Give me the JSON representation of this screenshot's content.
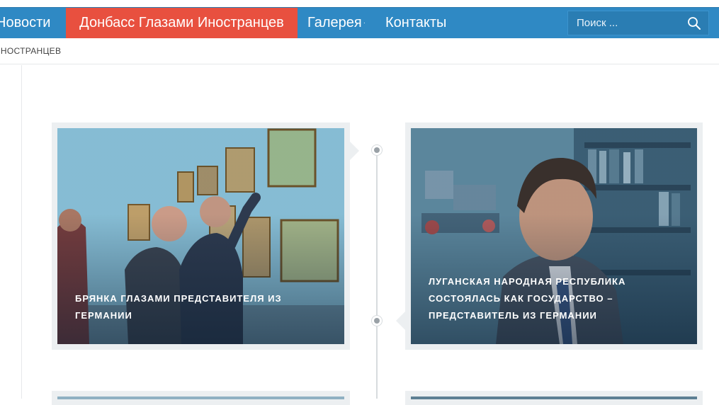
{
  "nav": {
    "items": [
      {
        "label": "Новости"
      },
      {
        "label": "Донбасс Глазами Иностранцев"
      },
      {
        "label": "Галерея"
      },
      {
        "label": "Контакты"
      }
    ],
    "active_index": 1,
    "gallery_dropdown_marker": "·"
  },
  "search": {
    "placeholder": "Поиск ..."
  },
  "breadcrumb": {
    "text": "ИНОСТРАНЦЕВ"
  },
  "colors": {
    "nav_bg": "#2f89c4",
    "nav_active": "#e8503f",
    "card_bg": "#eceff1"
  },
  "posts": [
    {
      "title": "Брянка глазами представителя из Германии"
    },
    {
      "title": "Луганская Народная Республика состоялась как государство – представитель из Германии"
    }
  ]
}
